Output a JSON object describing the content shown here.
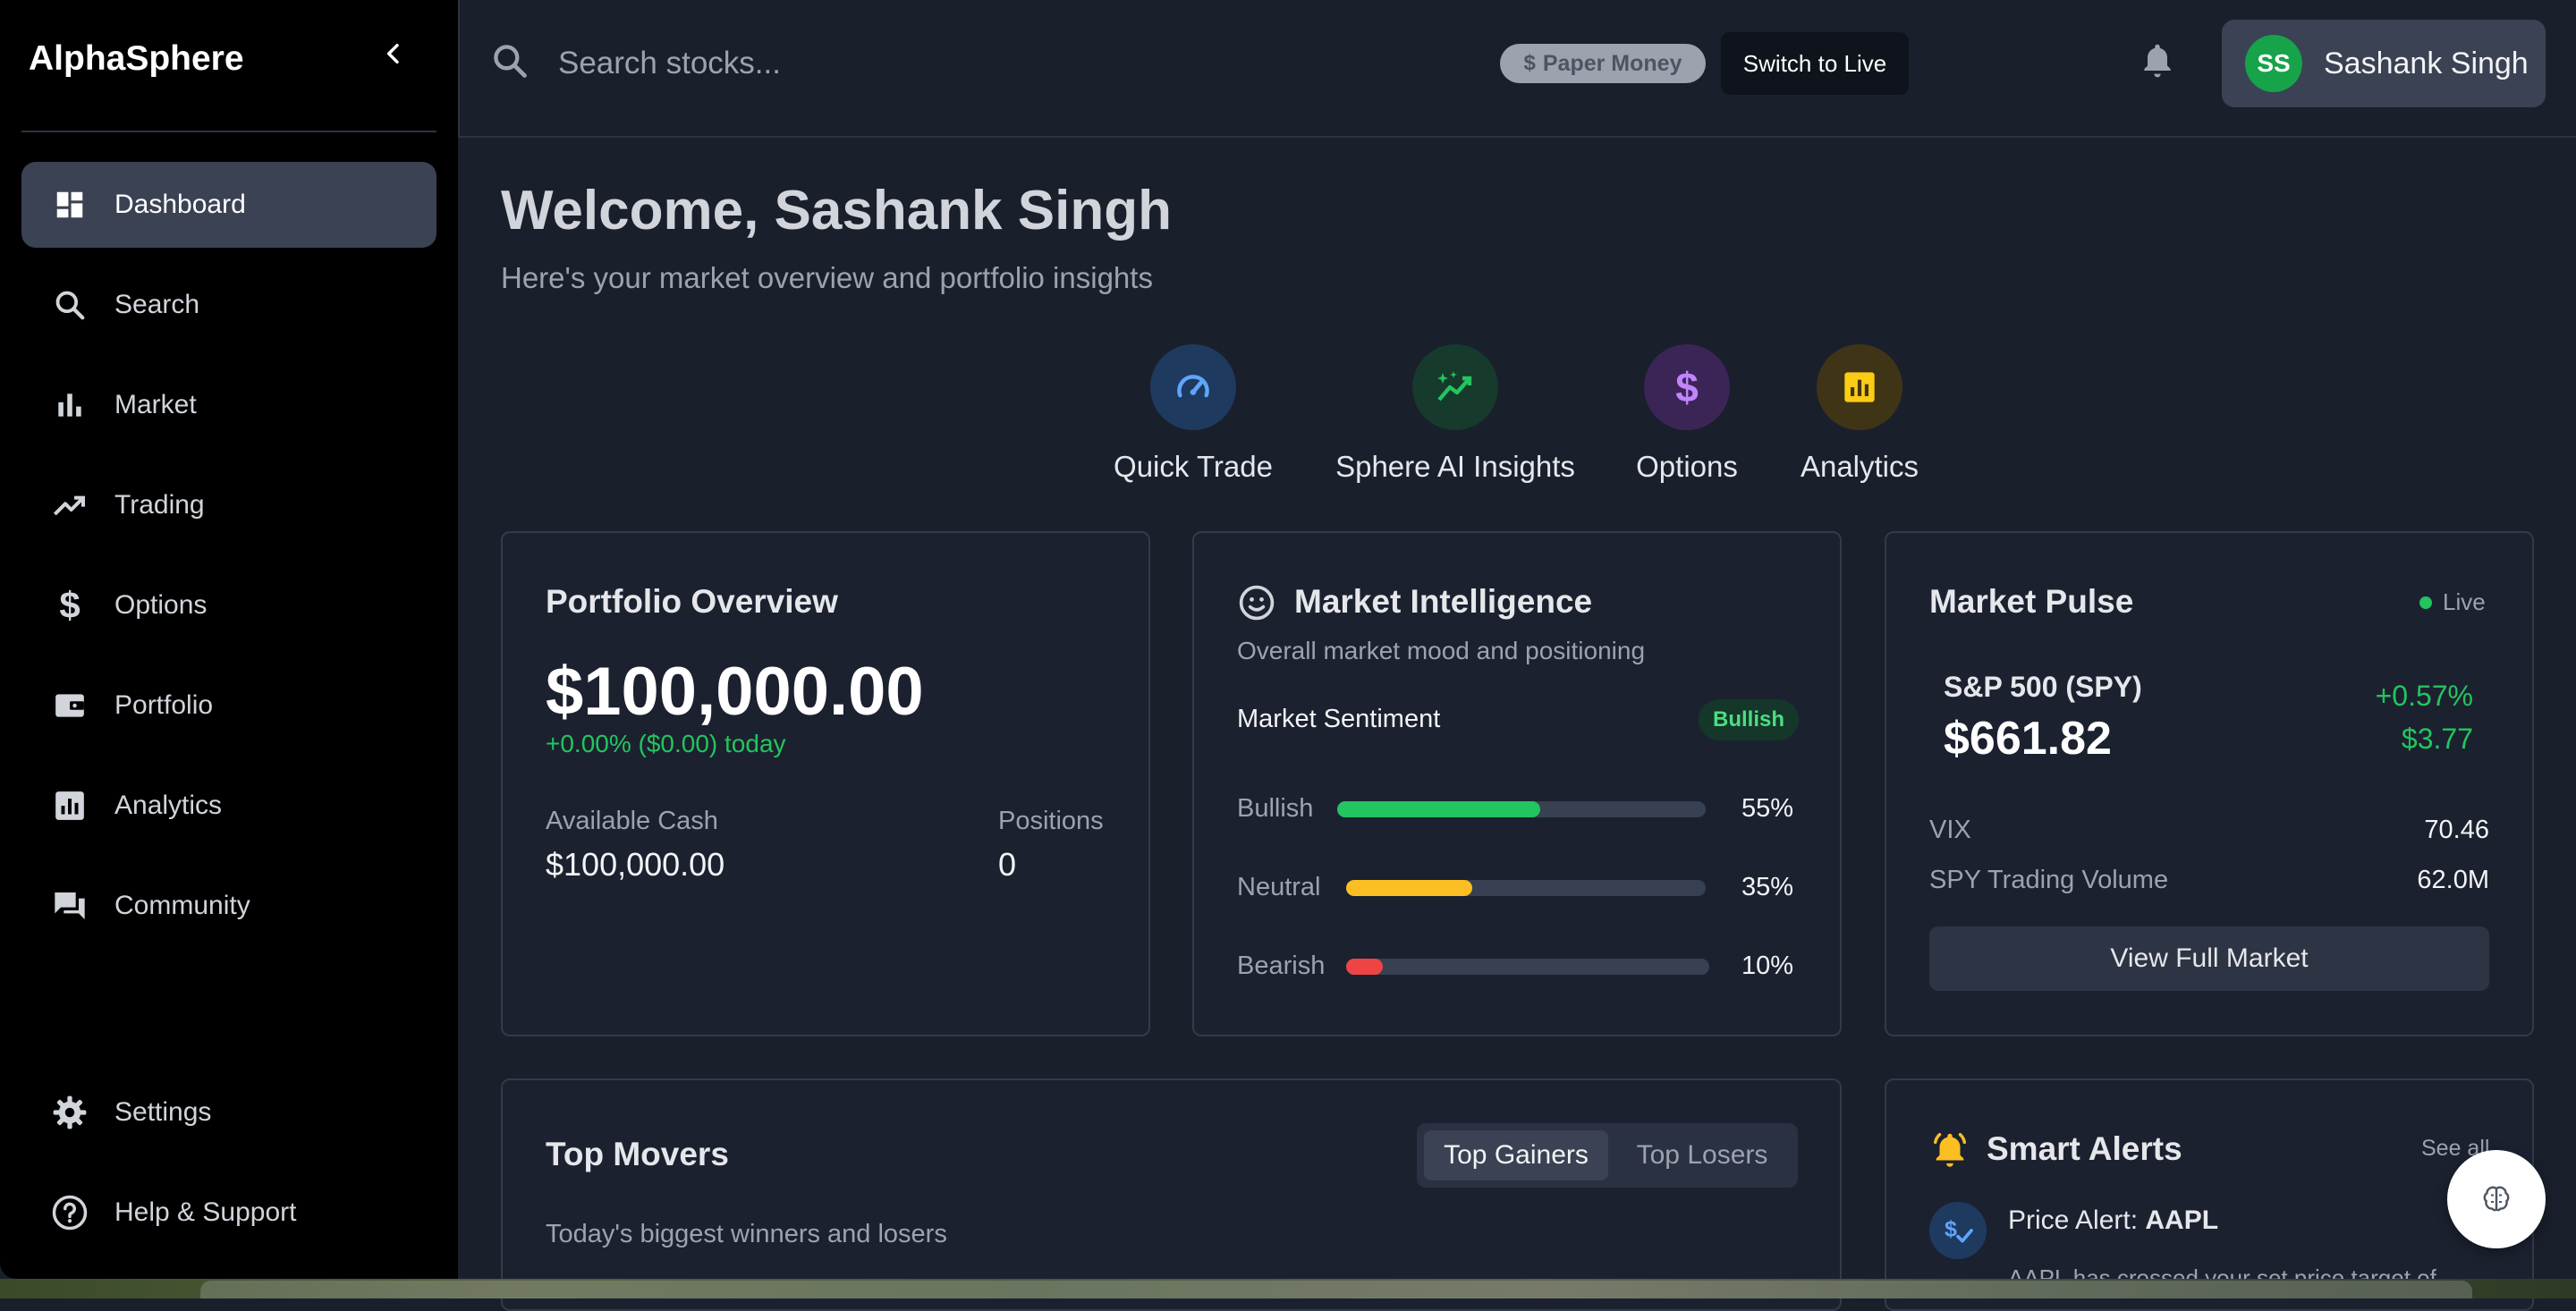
{
  "app": {
    "brand": "AlphaSphere"
  },
  "sidebar": {
    "items": [
      {
        "label": "Dashboard",
        "icon": "dashboard-icon",
        "active": true
      },
      {
        "label": "Search",
        "icon": "search-icon"
      },
      {
        "label": "Market",
        "icon": "bar-chart-icon"
      },
      {
        "label": "Trading",
        "icon": "trending-up-icon"
      },
      {
        "label": "Options",
        "icon": "dollar-icon"
      },
      {
        "label": "Portfolio",
        "icon": "wallet-icon"
      },
      {
        "label": "Analytics",
        "icon": "analytics-icon"
      },
      {
        "label": "Community",
        "icon": "chat-icon"
      }
    ],
    "bottom": [
      {
        "label": "Settings",
        "icon": "gear-icon"
      },
      {
        "label": "Help & Support",
        "icon": "help-icon"
      }
    ]
  },
  "topbar": {
    "search_placeholder": "Search stocks...",
    "paper_badge": "Paper Money",
    "switch_label": "Switch to Live",
    "user": {
      "initials": "SS",
      "name": "Sashank Singh"
    }
  },
  "welcome": {
    "title": "Welcome, Sashank Singh",
    "subtitle": "Here's your market overview and portfolio insights"
  },
  "quick_actions": [
    {
      "label": "Quick Trade",
      "icon": "speedometer-icon",
      "color": "#60a5fa"
    },
    {
      "label": "Sphere AI Insights",
      "icon": "sparkle-trend-icon",
      "color": "#22c55e"
    },
    {
      "label": "Options",
      "icon": "dollar-icon",
      "color": "#c084fc"
    },
    {
      "label": "Analytics",
      "icon": "analytics-icon",
      "color": "#facc15"
    }
  ],
  "portfolio": {
    "title": "Portfolio Overview",
    "value": "$100,000.00",
    "change": "+0.00% ($0.00) today",
    "cash_label": "Available Cash",
    "cash_value": "$100,000.00",
    "positions_label": "Positions",
    "positions_value": "0"
  },
  "intelligence": {
    "title": "Market Intelligence",
    "subtitle": "Overall market mood and positioning",
    "sentiment_label": "Market Sentiment",
    "sentiment_badge": "Bullish",
    "bars": [
      {
        "label": "Bullish",
        "value": 55,
        "pct": "55%",
        "color": "#22c55e"
      },
      {
        "label": "Neutral",
        "value": 35,
        "pct": "35%",
        "color": "#fbbf24"
      },
      {
        "label": "Bearish",
        "value": 10,
        "pct": "10%",
        "color": "#ef4444"
      }
    ]
  },
  "pulse": {
    "title": "Market Pulse",
    "live": "Live",
    "spy_label": "S&P 500 (SPY)",
    "spy_price": "$661.82",
    "spy_pct": "+0.57%",
    "spy_change": "$3.77",
    "vix_label": "VIX",
    "vix_value": "70.46",
    "volume_label": "SPY Trading Volume",
    "volume_value": "62.0M",
    "button": "View Full Market"
  },
  "movers": {
    "title": "Top Movers",
    "subtitle": "Today's biggest winners and losers",
    "tab_gainers": "Top Gainers",
    "tab_losers": "Top Losers"
  },
  "alerts": {
    "title": "Smart Alerts",
    "see_all": "See all",
    "item_prefix": "Price Alert: ",
    "item_symbol": "AAPL",
    "item_desc": "AAPL has crossed your set price target of"
  }
}
